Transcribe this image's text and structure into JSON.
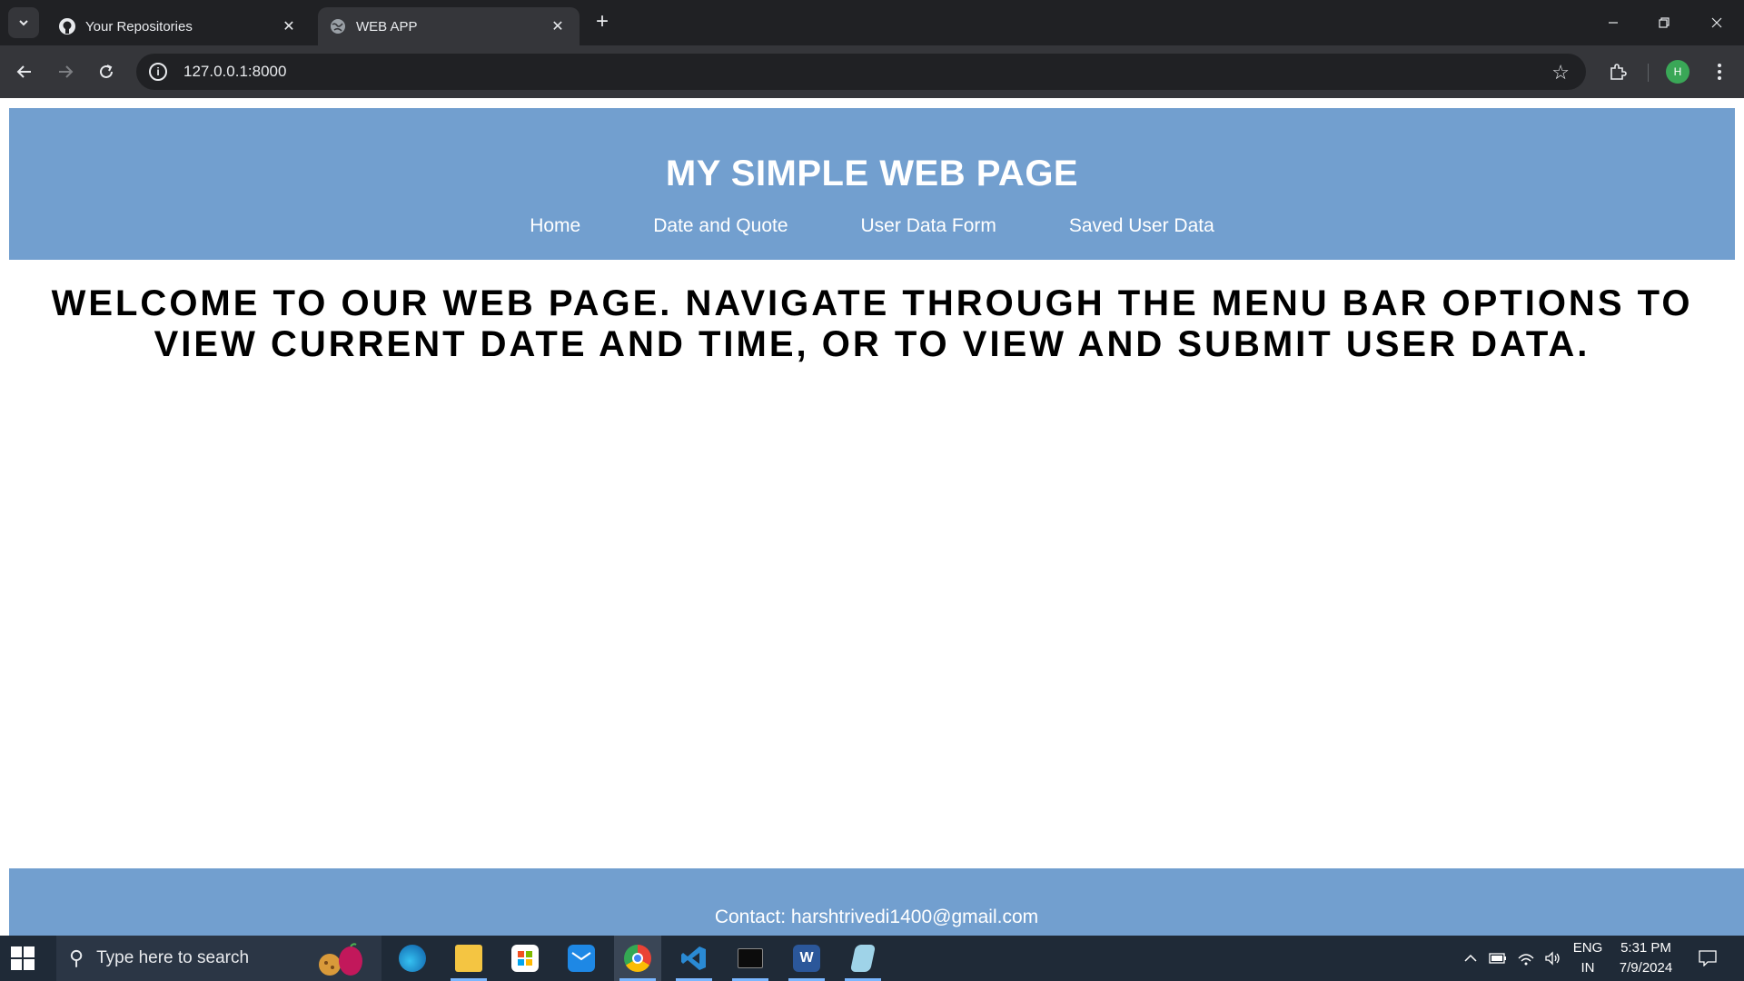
{
  "browser": {
    "tabs": [
      {
        "title": "Your Repositories",
        "active": false,
        "favicon": "github-icon"
      },
      {
        "title": "WEB APP",
        "active": true,
        "favicon": "globe-icon"
      }
    ],
    "address": "127.0.0.1:8000",
    "profile_initial": "H"
  },
  "page": {
    "site_title": "MY SIMPLE WEB PAGE",
    "nav": [
      "Home",
      "Date and Quote",
      "User Data Form",
      "Saved User Data"
    ],
    "welcome": "Welcome to our web page. Navigate through the menu bar options to view current date and time, or to view and submit user data.",
    "footer": "Contact: harshtrivedi1400@gmail.com",
    "colors": {
      "header_bg": "#729fcf",
      "header_text": "#ffffff"
    }
  },
  "taskbar": {
    "search_placeholder": "Type here to search",
    "apps": [
      "edge-icon",
      "file-explorer-icon",
      "store-icon",
      "mail-icon",
      "chrome-icon",
      "vscode-icon",
      "terminal-icon",
      "word-icon",
      "notepad-icon"
    ],
    "language_line1": "ENG",
    "language_line2": "IN",
    "time": "5:31 PM",
    "date": "7/9/2024"
  }
}
